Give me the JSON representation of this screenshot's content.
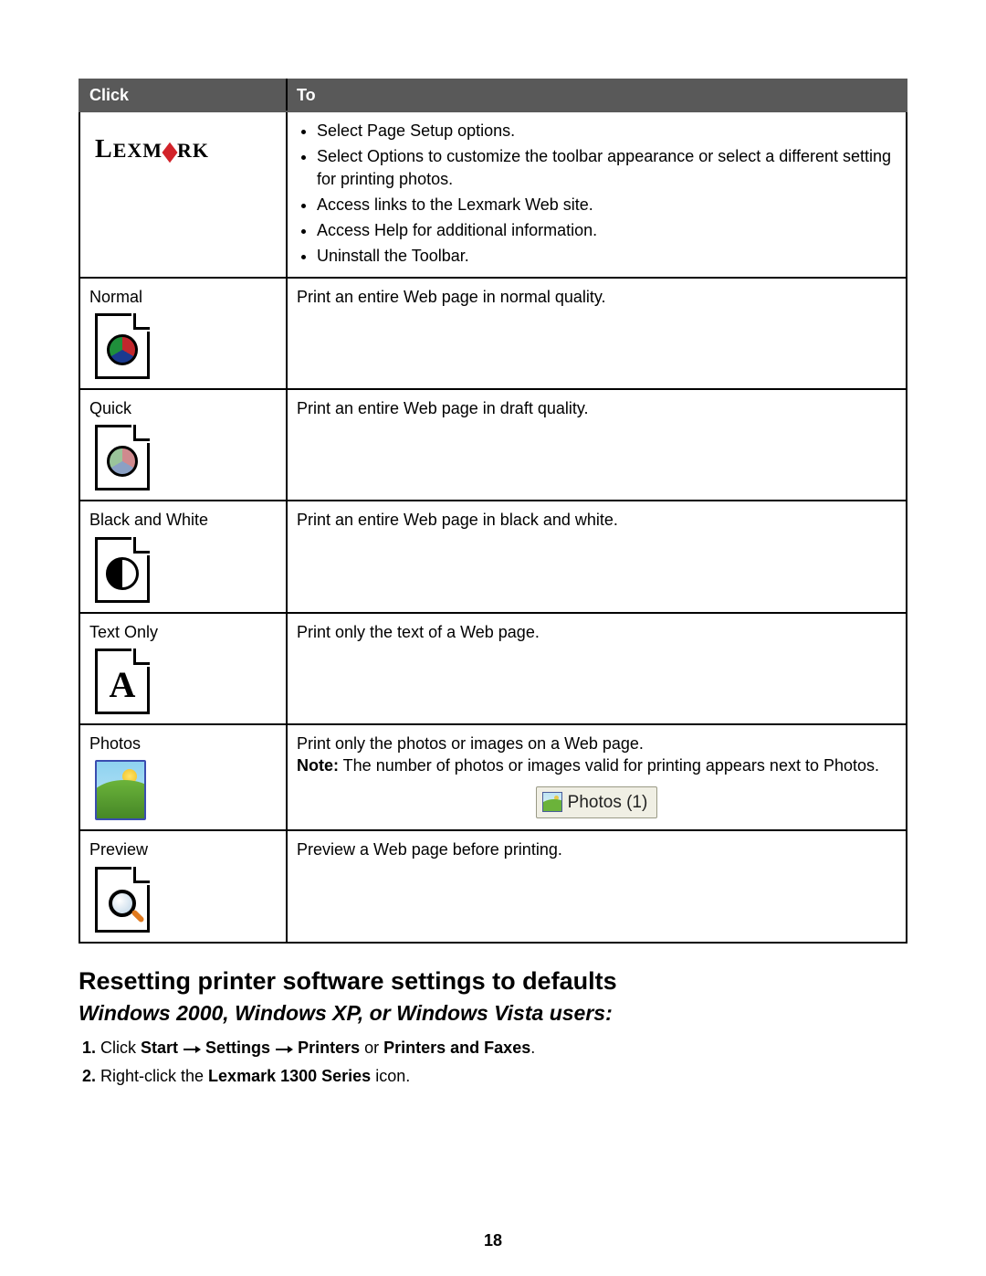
{
  "table": {
    "header": {
      "click": "Click",
      "to": "To"
    },
    "rows": {
      "lexmark": {
        "bullets": [
          "Select Page Setup options.",
          "Select Options to customize the toolbar appearance or select a different setting for printing photos.",
          "Access links to the Lexmark Web site.",
          "Access Help for additional information.",
          "Uninstall the Toolbar."
        ]
      },
      "normal": {
        "label": "Normal",
        "desc": "Print an entire Web page in normal quality."
      },
      "quick": {
        "label": "Quick",
        "desc": "Print an entire Web page in draft quality."
      },
      "bw": {
        "label": "Black and White",
        "desc": "Print an entire Web page in black and white."
      },
      "text": {
        "label": "Text Only",
        "desc": "Print only the text of a Web page."
      },
      "photos": {
        "label": "Photos",
        "desc": "Print only the photos or images on a Web page.",
        "note_label": "Note:",
        "note_body": " The number of photos or images valid for printing appears next to Photos.",
        "button_text": "Photos (1)"
      },
      "preview": {
        "label": "Preview",
        "desc": "Preview a Web page before printing."
      }
    }
  },
  "lexmark_logo": {
    "part1": "L",
    "part2": "EXM",
    "part3": "RK"
  },
  "section_heading": "Resetting printer software settings to defaults",
  "sub_heading": "Windows 2000, Windows XP, or Windows Vista users:",
  "steps": {
    "s1": {
      "prefix": "Click ",
      "b1": "Start",
      "b2": "Settings",
      "b3": "Printers",
      "or": " or ",
      "b4": "Printers and Faxes",
      "suffix": "."
    },
    "s2": {
      "prefix": "Right-click the ",
      "b1": "Lexmark 1300 Series",
      "suffix": " icon."
    }
  },
  "page_number": "18"
}
